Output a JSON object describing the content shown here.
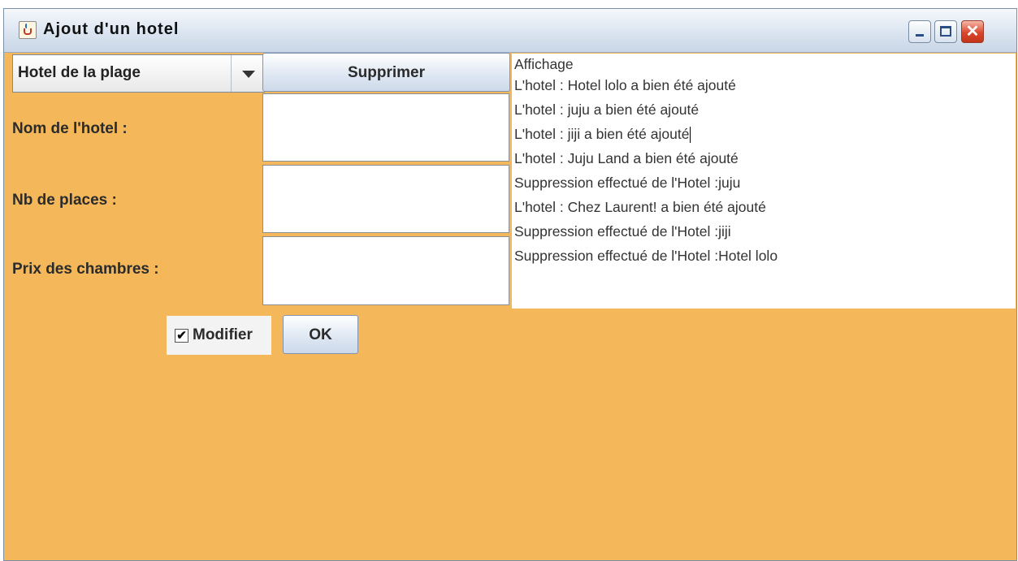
{
  "window": {
    "title": "Ajout d'un hotel",
    "controls": {
      "minimize": "_",
      "maximize": "□",
      "close": "✕"
    }
  },
  "hotel_select": {
    "selected": "Hotel de la plage"
  },
  "delete_button": {
    "label": "Supprimer"
  },
  "form": {
    "name_label": "Nom de l'hotel :",
    "name_value": "",
    "seats_label": "Nb de places :",
    "seats_value": "",
    "price_label": "Prix des chambres :",
    "price_value": ""
  },
  "modify_checkbox": {
    "label": "Modifier",
    "checked": true
  },
  "ok_button": {
    "label": "OK"
  },
  "log": {
    "lines": [
      "Affichage",
      "L'hotel : Hotel lolo a bien été ajouté",
      "L'hotel : juju a bien été ajouté",
      "L'hotel : jiji a bien été ajouté",
      "L'hotel : Juju Land a bien été ajouté",
      "Suppression effectué de l'Hotel :juju",
      "L'hotel : Chez Laurent! a bien été ajouté",
      "Suppression effectué de l'Hotel :jiji",
      "Suppression effectué de l'Hotel :Hotel lolo"
    ]
  },
  "colors": {
    "panel_background": "#f4b85a",
    "titlebar": "#dbe5f1"
  },
  "icons": {
    "app": "java-cup-icon",
    "checkbox": "checkmark-icon",
    "dropdown": "triangle-down-icon"
  }
}
